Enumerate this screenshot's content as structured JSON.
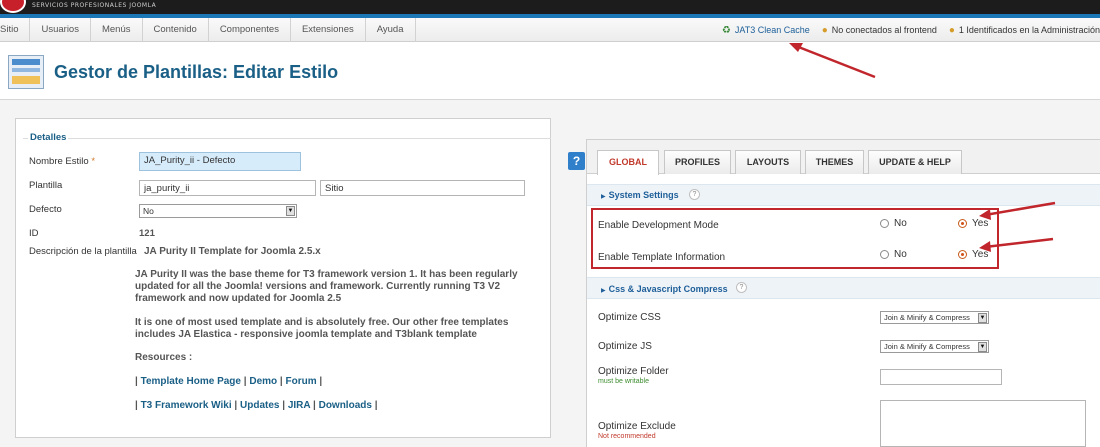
{
  "header": {
    "slogan": "SERVICIOS PROFESIONALES JOOMLA"
  },
  "menu": {
    "items": [
      "Sitio",
      "Usuarios",
      "Menús",
      "Contenido",
      "Componentes",
      "Extensiones",
      "Ayuda"
    ]
  },
  "status": {
    "cache": "JAT3 Clean Cache",
    "frontend": "No conectados al frontend",
    "admin": "1 Identificados en la Administración"
  },
  "page": {
    "title": "Gestor de Plantillas: Editar Estilo"
  },
  "details": {
    "legend": "Detalles",
    "style_name_label": "Nombre Estilo",
    "required_mark": "*",
    "style_name_value": "JA_Purity_ii - Defecto",
    "template_label": "Plantilla",
    "template_value": "ja_purity_ii",
    "client_value": "Sitio",
    "default_label": "Defecto",
    "default_value": "No",
    "id_label": "ID",
    "id_value": "121",
    "description_label": "Descripción de la plantilla",
    "description_title": "JA Purity II Template for Joomla 2.5.x",
    "description_p1": "JA Purity II was the base theme for T3 framework version 1. It has been regularly updated for all the Joomla! versions and framework. Currently running T3 V2 framework and now updated for Joomla 2.5",
    "description_p2": "It is one of most used template and is absolutely free. Our other free templates includes JA Elastica - responsive joomla template and T3blank template",
    "resources_label": "Resources :",
    "links_row1": [
      "Template Home Page",
      "Demo",
      "Forum"
    ],
    "links_row2": [
      "T3 Framework Wiki",
      "Updates",
      "JIRA",
      "Downloads"
    ]
  },
  "tabs": [
    "GLOBAL",
    "PROFILES",
    "LAYOUTS",
    "THEMES",
    "UPDATE & HELP"
  ],
  "active_tab": "GLOBAL",
  "system_settings": {
    "title": "System Settings",
    "dev_mode_label": "Enable Development Mode",
    "dev_mode_value": "Yes",
    "template_info_label": "Enable Template Information",
    "template_info_value": "Yes",
    "no_label": "No",
    "yes_label": "Yes"
  },
  "compress": {
    "title": "Css & Javascript Compress",
    "optimize_css_label": "Optimize CSS",
    "optimize_css_value": "Join & Minify & Compress",
    "optimize_js_label": "Optimize JS",
    "optimize_js_value": "Join & Minify & Compress",
    "optimize_folder_label": "Optimize Folder",
    "optimize_folder_note": "must be writable",
    "optimize_folder_value": "",
    "optimize_exclude_label": "Optimize Exclude",
    "optimize_exclude_note": "Not recommended",
    "optimize_exclude_value": ""
  },
  "colors": {
    "accent": "#1a5f86",
    "annotation": "#c0262c",
    "active_tab": "#c0392b"
  }
}
